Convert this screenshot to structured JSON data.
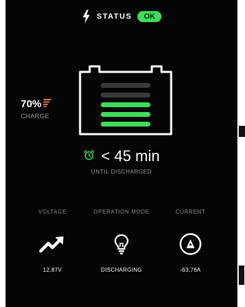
{
  "status": {
    "label": "STATUS",
    "badge": "OK"
  },
  "battery": {
    "level_fraction": 0.7
  },
  "charge": {
    "percent": "70%",
    "label": "CHARGE"
  },
  "timer": {
    "value": "< 45 min",
    "label": "UNTIL DISCHARGED"
  },
  "stats": [
    {
      "title": "VOLTAGE",
      "value": "12,87V",
      "icon": "trend-up-icon"
    },
    {
      "title": "OPERATION MODE",
      "value": "DISCHARGING",
      "icon": "lightbulb-icon"
    },
    {
      "title": "CURRENT",
      "value": "-63,76A",
      "icon": "ampere-icon"
    }
  ],
  "colors": {
    "accent": "#3fdc59",
    "charge_orange": "#e8732d",
    "background": "#050505"
  }
}
